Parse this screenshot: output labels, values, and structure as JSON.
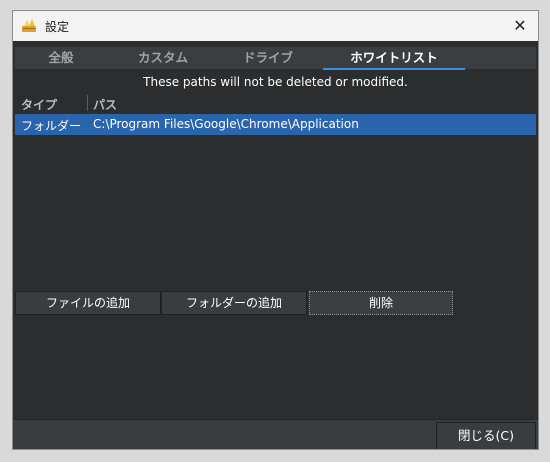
{
  "window": {
    "title": "設定",
    "app_icon": "broom-icon",
    "close_icon": "close-icon"
  },
  "tabs": [
    {
      "label": "全般",
      "active": false
    },
    {
      "label": "カスタム",
      "active": false
    },
    {
      "label": "ドライブ",
      "active": false
    },
    {
      "label": "ホワイトリスト",
      "active": true
    }
  ],
  "notice": "These paths will not be deleted or modified.",
  "list": {
    "columns": [
      "タイプ",
      "パス"
    ],
    "rows": [
      {
        "type": "フォルダー",
        "path": "C:\\Program Files\\Google\\Chrome\\Application",
        "selected": true
      }
    ]
  },
  "buttons": {
    "add_file": "ファイルの追加",
    "add_folder": "フォルダーの追加",
    "delete": "削除"
  },
  "footer": {
    "close_label": "閉じる(C)"
  },
  "colors": {
    "accent": "#3d8ee6",
    "selection": "#2a64ac",
    "background": "#2b2d2f"
  }
}
